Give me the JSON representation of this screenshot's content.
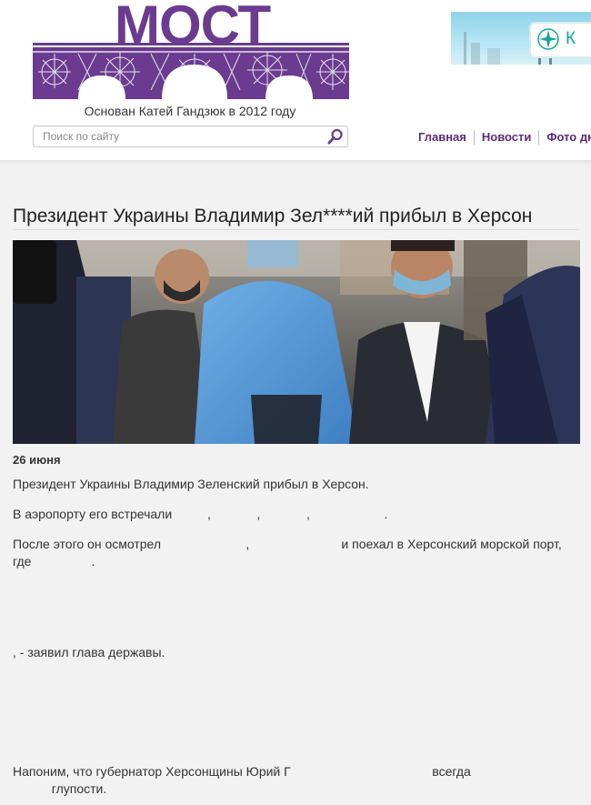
{
  "site": {
    "logo_text": "МОСТ",
    "tagline": "Основан Катей Гандзюк в 2012 году"
  },
  "ad": {
    "text": "К"
  },
  "search": {
    "placeholder": "Поиск по сайту"
  },
  "nav": {
    "items": [
      {
        "label": "Главная"
      },
      {
        "label": "Новости"
      },
      {
        "label": "Фото дня"
      }
    ]
  },
  "article": {
    "title": "Президент Украины Владимир Зел****ий прибыл в Херсон",
    "date": "26 июня",
    "paragraphs": [
      "Президент Украины Владимир Зеленский прибыл в Херсон.",
      "В аэропорту его встречали          ,             ,             ,                     .",
      "После этого он осмотрел                        ,                          и поехал в Херсонский морской порт, где                 .",
      ", - заявил глава державы.",
      "Напоним, что губернатор Херсонщины Юрий Г                                        всегда\n           глупости."
    ]
  },
  "colors": {
    "brand_purple": "#6a3b8f",
    "nav_purple": "#5b2a7c",
    "page_bg": "#f2f2f2"
  }
}
